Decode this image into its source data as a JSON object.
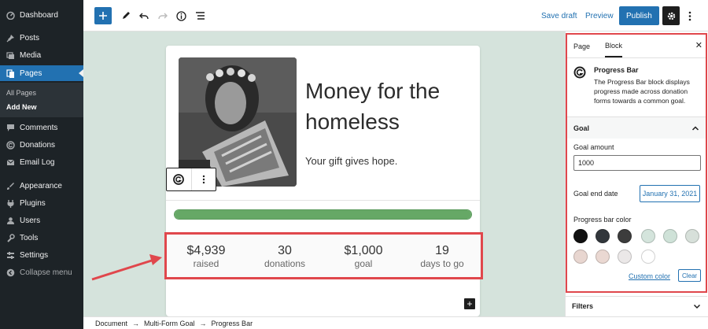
{
  "sidebar": {
    "items": [
      {
        "label": "Dashboard",
        "icon": "dashboard-icon"
      },
      {
        "label": "Posts",
        "icon": "pin-icon"
      },
      {
        "label": "Media",
        "icon": "media-icon"
      },
      {
        "label": "Pages",
        "icon": "pages-icon"
      },
      {
        "label": "Comments",
        "icon": "comments-icon"
      },
      {
        "label": "Donations",
        "icon": "givewp-icon"
      },
      {
        "label": "Email Log",
        "icon": "email-icon"
      },
      {
        "label": "Appearance",
        "icon": "brush-icon"
      },
      {
        "label": "Plugins",
        "icon": "plugin-icon"
      },
      {
        "label": "Users",
        "icon": "users-icon"
      },
      {
        "label": "Tools",
        "icon": "wrench-icon"
      },
      {
        "label": "Settings",
        "icon": "settings-icon"
      },
      {
        "label": "Collapse menu",
        "icon": "collapse-icon"
      }
    ],
    "submenu": {
      "all_pages": "All Pages",
      "add_new": "Add New"
    }
  },
  "toolbar": {
    "save_draft": "Save draft",
    "preview": "Preview",
    "publish": "Publish"
  },
  "block": {
    "title": "Money for the homeless",
    "tagline": "Your gift gives hope.",
    "progress_fraction": 1.0,
    "stats": [
      {
        "value": "$4,939",
        "label": "raised"
      },
      {
        "value": "30",
        "label": "donations"
      },
      {
        "value": "$1,000",
        "label": "goal"
      },
      {
        "value": "19",
        "label": "days to go"
      }
    ]
  },
  "breadcrumb": [
    "Document",
    "Multi-Form Goal",
    "Progress Bar"
  ],
  "inspector": {
    "tabs": [
      "Page",
      "Block"
    ],
    "block_name": "Progress Bar",
    "block_desc": "The Progress Bar block displays progress made across donation forms towards a common goal.",
    "panel_title": "Goal",
    "goal_amount_label": "Goal amount",
    "goal_amount_value": "1000",
    "goal_end_date_label": "Goal end date",
    "goal_end_date_value": "January 31, 2021",
    "bar_color_label": "Progress bar color",
    "swatches": [
      "#111111",
      "#32373c",
      "#3c3c3c",
      "#d4e4dc",
      "#cfe2d8",
      "#d7e0da",
      "#e8d6d0",
      "#ead8d2",
      "#ebe8e8",
      "#ffffff"
    ],
    "custom_color": "Custom color",
    "clear": "Clear",
    "filters": "Filters"
  },
  "colors": {
    "accent": "#2271b1",
    "sidebar_bg": "#1d2327",
    "highlight_red": "#e0474c",
    "progress_green": "#66a866",
    "canvas_bg": "#d5e3dc"
  }
}
